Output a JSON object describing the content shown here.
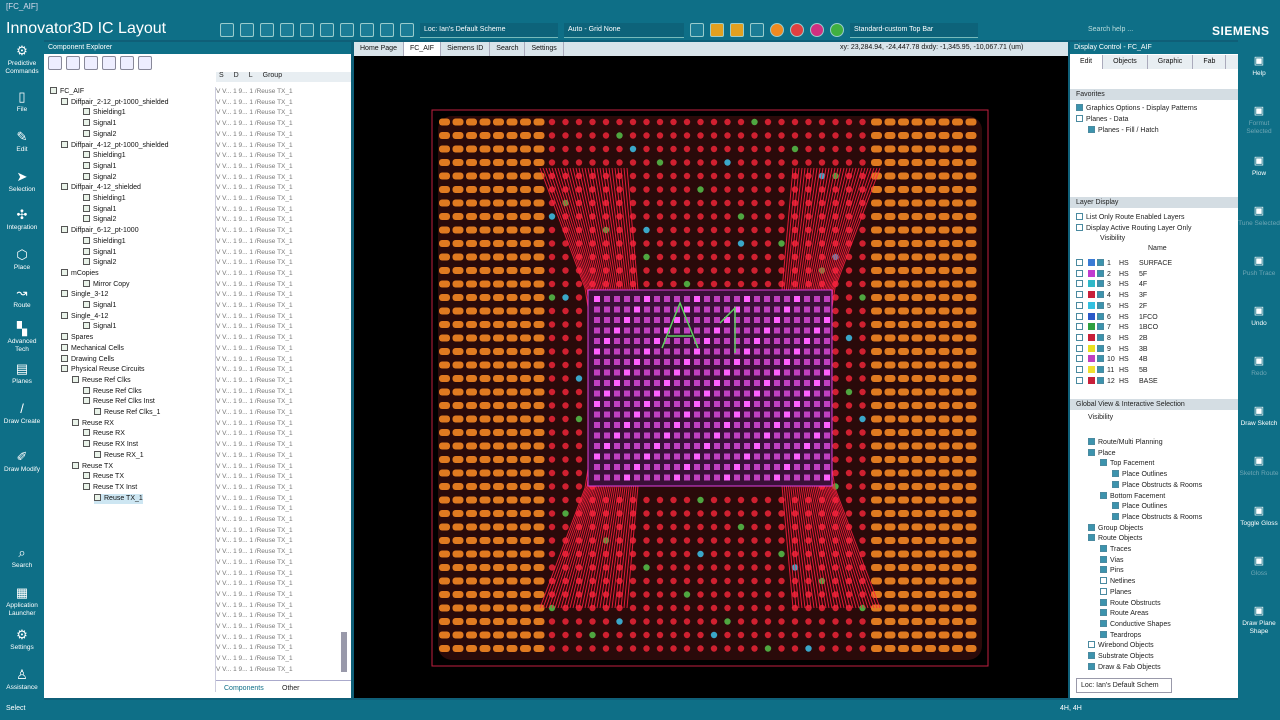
{
  "window": {
    "title": "[FC_AIF]",
    "app_title": "Innovator3D IC Layout",
    "brand": "SIEMENS",
    "search_placeholder": "Search help ..."
  },
  "toolbar": {
    "scheme": "Loc: Ian's Default Scheme",
    "grid": "Auto - Grid None",
    "topbar": "Standard-custom Top Bar"
  },
  "leftbar": [
    {
      "label": "Predictive Commands",
      "icon": "⚙"
    },
    {
      "label": "File",
      "icon": "▯"
    },
    {
      "label": "Edit",
      "icon": "✎"
    },
    {
      "label": "Selection",
      "icon": "➤"
    },
    {
      "label": "Integration",
      "icon": "✣"
    },
    {
      "label": "Place",
      "icon": "⬡"
    },
    {
      "label": "Route",
      "icon": "↝"
    },
    {
      "label": "Advanced Tech",
      "icon": "▚"
    },
    {
      "label": "Planes",
      "icon": "▤"
    },
    {
      "label": "Draw Create",
      "icon": "/"
    },
    {
      "label": "Draw Modify",
      "icon": "✐"
    },
    {
      "label": "Search",
      "icon": "⌕"
    },
    {
      "label": "Application Launcher",
      "icon": "▦"
    },
    {
      "label": "Settings",
      "icon": "⚙"
    },
    {
      "label": "Assistance",
      "icon": "♙"
    }
  ],
  "rightbar": [
    {
      "label": "Help",
      "dim": false
    },
    {
      "label": "Formut Selected",
      "dim": true
    },
    {
      "label": "Plow",
      "dim": false
    },
    {
      "label": "Tune Selected",
      "dim": true
    },
    {
      "label": "Push Trace",
      "dim": true
    },
    {
      "label": "Undo",
      "dim": false
    },
    {
      "label": "Redo",
      "dim": true
    },
    {
      "label": "Draw Sketch",
      "dim": false
    },
    {
      "label": "Sketch Route",
      "dim": true
    },
    {
      "label": "Toggle Gloss",
      "dim": false
    },
    {
      "label": "Gloss",
      "dim": true
    },
    {
      "label": "Draw Plane Shape",
      "dim": false
    }
  ],
  "component_explorer": {
    "title": "Component Explorer",
    "columns": [
      "S",
      "D",
      "L",
      "Group"
    ],
    "tree": [
      {
        "label": "FC_AIF",
        "indent": 0
      },
      {
        "label": "Diffpair_2-12_pt-1000_shielded",
        "indent": 1
      },
      {
        "label": "Shielding1",
        "indent": 3
      },
      {
        "label": "Signal1",
        "indent": 3
      },
      {
        "label": "Signal2",
        "indent": 3
      },
      {
        "label": "Diffpair_4-12_pt-1000_shielded",
        "indent": 1
      },
      {
        "label": "Shielding1",
        "indent": 3
      },
      {
        "label": "Signal1",
        "indent": 3
      },
      {
        "label": "Signal2",
        "indent": 3
      },
      {
        "label": "Diffpair_4-12_shielded",
        "indent": 1
      },
      {
        "label": "Shielding1",
        "indent": 3
      },
      {
        "label": "Signal1",
        "indent": 3
      },
      {
        "label": "Signal2",
        "indent": 3
      },
      {
        "label": "Diffpair_6-12_pt-1000",
        "indent": 1
      },
      {
        "label": "Shielding1",
        "indent": 3
      },
      {
        "label": "Signal1",
        "indent": 3
      },
      {
        "label": "Signal2",
        "indent": 3
      },
      {
        "label": "mCopies",
        "indent": 1
      },
      {
        "label": "Mirror Copy",
        "indent": 3
      },
      {
        "label": "Single_3-12",
        "indent": 1
      },
      {
        "label": "Signal1",
        "indent": 3
      },
      {
        "label": "Single_4-12",
        "indent": 1
      },
      {
        "label": "Signal1",
        "indent": 3
      },
      {
        "label": "Spares",
        "indent": 1
      },
      {
        "label": "Mechanical Cells",
        "indent": 1
      },
      {
        "label": "Drawing Cells",
        "indent": 1
      },
      {
        "label": "Physical Reuse Circuits",
        "indent": 1
      },
      {
        "label": "Reuse Ref Clks",
        "indent": 2
      },
      {
        "label": "Reuse Ref Clks",
        "indent": 3
      },
      {
        "label": "Reuse Ref Clks Inst",
        "indent": 3
      },
      {
        "label": "Reuse Ref Clks_1",
        "indent": 4
      },
      {
        "label": "Reuse RX",
        "indent": 2
      },
      {
        "label": "Reuse RX",
        "indent": 3
      },
      {
        "label": "Reuse RX Inst",
        "indent": 3
      },
      {
        "label": "Reuse RX_1",
        "indent": 4
      },
      {
        "label": "Reuse TX",
        "indent": 2
      },
      {
        "label": "Reuse TX",
        "indent": 3
      },
      {
        "label": "Reuse TX Inst",
        "indent": 3
      },
      {
        "label": "Reuse TX_1",
        "indent": 4
      }
    ],
    "grid_row": "V  V...  1  9...  1  /Reuse TX_1",
    "tabs": [
      "Components",
      "Other"
    ]
  },
  "doc_tabs": [
    "Home Page",
    "FC_AIF",
    "Siemens ID",
    "Search",
    "Settings"
  ],
  "coords": "xy: 23,284.94, -24,447.78  dxdy: -1,345.95, -10,067.71  (um)",
  "display_control": {
    "title": "Display Control - FC_AIF",
    "tabs": [
      "Edit",
      "Objects",
      "Graphic",
      "Fab"
    ],
    "favorites_head": "Favorites",
    "favorites": [
      "Graphics Options - Display Patterns",
      "Planes - Data",
      "Planes - Fill / Hatch"
    ],
    "layer_head": "Layer Display",
    "layer_opts": [
      "List Only Route Enabled Layers",
      "Display Active Routing Layer Only"
    ],
    "visibility": "Visibility",
    "name_col": "Name",
    "layers": [
      {
        "n": "1",
        "t": "HS",
        "name": "SURFACE",
        "color": "#3a7bd5"
      },
      {
        "n": "2",
        "t": "HS",
        "name": "5F",
        "color": "#c13bd0"
      },
      {
        "n": "3",
        "t": "HS",
        "name": "4F",
        "color": "#2fb8c8"
      },
      {
        "n": "4",
        "t": "HS",
        "name": "3F",
        "color": "#c8203a"
      },
      {
        "n": "5",
        "t": "HS",
        "name": "2F",
        "color": "#33c0e0"
      },
      {
        "n": "6",
        "t": "HS",
        "name": "1FCO",
        "color": "#2a59c8"
      },
      {
        "n": "7",
        "t": "HS",
        "name": "1BCO",
        "color": "#2ea040"
      },
      {
        "n": "8",
        "t": "HS",
        "name": "2B",
        "color": "#c8203a"
      },
      {
        "n": "9",
        "t": "HS",
        "name": "3B",
        "color": "#e8e020"
      },
      {
        "n": "10",
        "t": "HS",
        "name": "4B",
        "color": "#c040c0"
      },
      {
        "n": "11",
        "t": "HS",
        "name": "5B",
        "color": "#f0e030"
      },
      {
        "n": "12",
        "t": "HS",
        "name": "BASE",
        "color": "#c8203a"
      }
    ],
    "global_head": "Global View & Interactive Selection",
    "global": [
      {
        "label": "Route/Multi Planning",
        "indent": 1,
        "on": true
      },
      {
        "label": "Place",
        "indent": 1,
        "on": true
      },
      {
        "label": "Top Facement",
        "indent": 2,
        "on": true
      },
      {
        "label": "Place Outlines",
        "indent": 3,
        "on": true
      },
      {
        "label": "Place Obstructs & Rooms",
        "indent": 3,
        "on": true
      },
      {
        "label": "Bottom Facement",
        "indent": 2,
        "on": true
      },
      {
        "label": "Place Outlines",
        "indent": 3,
        "on": true
      },
      {
        "label": "Place Obstructs & Rooms",
        "indent": 3,
        "on": true
      },
      {
        "label": "Group Objects",
        "indent": 1,
        "on": true
      },
      {
        "label": "Route Objects",
        "indent": 1,
        "on": true
      },
      {
        "label": "Traces",
        "indent": 2,
        "on": true
      },
      {
        "label": "Vias",
        "indent": 2,
        "on": true
      },
      {
        "label": "Pins",
        "indent": 2,
        "on": true
      },
      {
        "label": "Netlines",
        "indent": 2,
        "on": false
      },
      {
        "label": "Planes",
        "indent": 2,
        "on": false
      },
      {
        "label": "Route Obstructs",
        "indent": 2,
        "on": true
      },
      {
        "label": "Route Areas",
        "indent": 2,
        "on": true
      },
      {
        "label": "Conductive Shapes",
        "indent": 2,
        "on": true
      },
      {
        "label": "Teardrops",
        "indent": 2,
        "on": true
      },
      {
        "label": "Wirebond Objects",
        "indent": 1,
        "on": false
      },
      {
        "label": "Substrate Objects",
        "indent": 1,
        "on": true
      },
      {
        "label": "Draw & Fab Objects",
        "indent": 1,
        "on": true
      }
    ],
    "scheme": "Loc: Ian's Default Schem"
  },
  "status": {
    "left": "Select",
    "right": "4H, 4H"
  }
}
